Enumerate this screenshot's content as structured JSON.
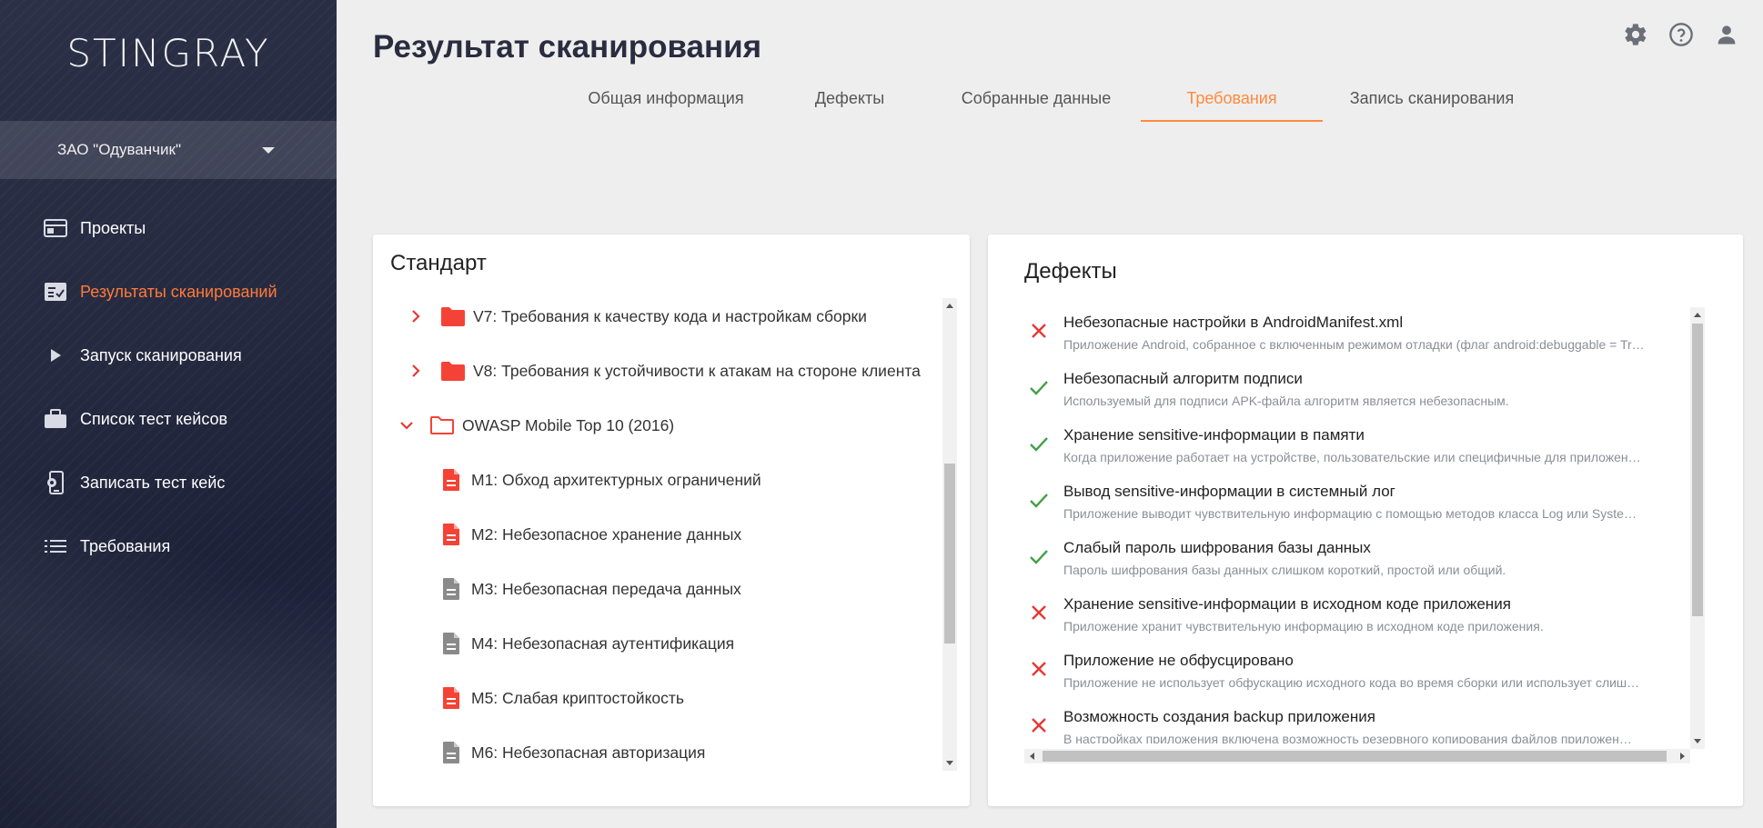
{
  "app": {
    "logo": "STINGRAY"
  },
  "org": {
    "name": "ЗАО \"Одуванчик\""
  },
  "nav": {
    "items": [
      {
        "label": "Проекты",
        "icon": "projects-icon"
      },
      {
        "label": "Результаты сканирований",
        "icon": "scan-results-icon",
        "active": true
      },
      {
        "label": "Запуск сканирования",
        "icon": "play-icon"
      },
      {
        "label": "Список тест кейсов",
        "icon": "briefcase-icon"
      },
      {
        "label": "Записать тест кейс",
        "icon": "record-testcase-icon"
      },
      {
        "label": "Требования",
        "icon": "list-icon"
      }
    ]
  },
  "header": {
    "title": "Результат сканирования",
    "icons": [
      "settings-icon",
      "help-icon",
      "account-icon"
    ]
  },
  "tabs": [
    {
      "label": "Общая информация"
    },
    {
      "label": "Дефекты"
    },
    {
      "label": "Собранные данные"
    },
    {
      "label": "Требования",
      "active": true
    },
    {
      "label": "Запись сканирования"
    }
  ],
  "standard": {
    "title": "Стандарт",
    "tree": [
      {
        "label": "V7: Требования к качеству кода и настройкам сборки",
        "type": "folder",
        "state": "collapsed",
        "status": "fail"
      },
      {
        "label": "V8: Требования к устойчивости к атакам на стороне клиента",
        "type": "folder",
        "state": "collapsed",
        "status": "fail"
      },
      {
        "label": "OWASP Mobile Top 10 (2016)",
        "type": "folder",
        "state": "expanded",
        "status": "fail"
      },
      {
        "label": "M1: Обход архитектурных ограничений",
        "type": "file",
        "status": "fail"
      },
      {
        "label": "M2: Небезопасное хранение данных",
        "type": "file",
        "status": "fail"
      },
      {
        "label": "M3: Небезопасная передача данных",
        "type": "file",
        "status": "neutral"
      },
      {
        "label": "M4: Небезопасная аутентификация",
        "type": "file",
        "status": "neutral"
      },
      {
        "label": "M5: Слабая криптостойкость",
        "type": "file",
        "status": "fail"
      },
      {
        "label": "M6: Небезопасная авторизация",
        "type": "file",
        "status": "neutral"
      }
    ]
  },
  "defects": {
    "title": "Дефекты",
    "items": [
      {
        "status": "fail",
        "title": "Небезопасные настройки в AndroidManifest.xml",
        "desc": "Приложение Android, собранное с включенным режимом отладки (флаг android:debuggable = Tr…"
      },
      {
        "status": "pass",
        "title": "Небезопасный алгоритм подписи",
        "desc": "Используемый для подписи APK-файла алгоритм является небезопасным."
      },
      {
        "status": "pass",
        "title": "Хранение sensitive-информации в памяти",
        "desc": "Когда приложение работает на устройстве, пользовательские или специфичные для приложен…"
      },
      {
        "status": "pass",
        "title": "Вывод sensitive-информации в системный лог",
        "desc": "Приложение выводит чувствительную информацию с помощью методов класса Log или Syste…"
      },
      {
        "status": "pass",
        "title": "Слабый пароль шифрования базы данных",
        "desc": "Пароль шифрования базы данных слишком короткий, простой или общий."
      },
      {
        "status": "fail",
        "title": "Хранение sensitive-информации в исходном коде приложения",
        "desc": "Приложение хранит чувствительную информацию в исходном коде приложения."
      },
      {
        "status": "fail",
        "title": "Приложение не обфусцировано",
        "desc": "Приложение не использует обфускацию исходного кода во время сборки или использует слиш…"
      },
      {
        "status": "fail",
        "title": "Возможность создания backup приложения",
        "desc": "В настройках приложения включена возможность резервного копирования файлов приложен…"
      }
    ]
  },
  "colors": {
    "accent": "#ff7a3a",
    "fail": "#e53935",
    "pass": "#43a047",
    "neutral": "#8a8a8a"
  }
}
